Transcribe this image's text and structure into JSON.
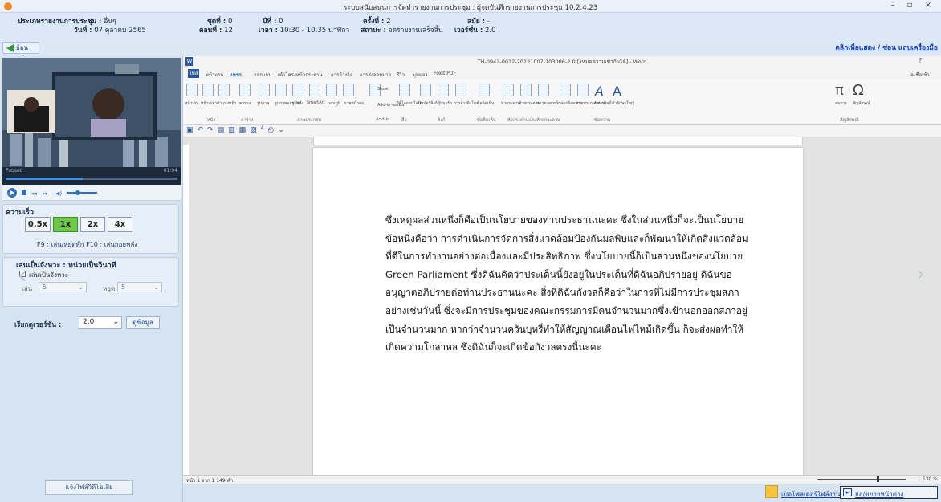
{
  "window": {
    "title": "ระบบสนับสนุนการจัดทำรายงานการประชุม : ผู้จดบันทึกรายงานการประชุม 10.2.4.23",
    "controls": "– ▫ ×"
  },
  "info": {
    "meeting_type_label": "ประเภทรายงานการประชุม :",
    "meeting_type_value": "อื่นๆ",
    "date_label": "วันที่ :",
    "date_value": "07 ตุลาคม 2565",
    "group_label": "ชุดที่ :",
    "group_value": "0",
    "year_label": "ปีที่ :",
    "year_value": "0",
    "session_label": "ครั้งที่ :",
    "session_value": "2",
    "term_label": "สมัย :",
    "term_value": "-",
    "episode_label": "ตอนที่ :",
    "episode_value": "12",
    "time_label": "เวลา :",
    "time_value": "10:30 - 10:35 นาฬิกา",
    "status_label": "สถานะ :",
    "status_value": "จดรายงานเสร็จสิ้น",
    "version_label": "เวอร์ชั่น :",
    "version_value": "2.0"
  },
  "toolbar": {
    "back_label": "ย้อนกลับ",
    "toggle_label": "คลิกเพื่อแสดง / ซ่อน แถบเครื่องมือ"
  },
  "player": {
    "state": "Paused",
    "time": "01:04",
    "progress": 0.45
  },
  "speed": {
    "title": "ความเร็ว",
    "options": [
      "0.5x",
      "1x",
      "2x",
      "4x"
    ],
    "selected": "1x",
    "hint": "F9 : เล่น/หยุดพัก  F10 : เล่นถอยหลัง"
  },
  "loop": {
    "title": "เล่นเป็นจังหวะ : หน่วยเป็นวินาที",
    "checkbox_label": "เล่นเป็นจังหวะ",
    "play_label": "เล่น",
    "play_value": "5",
    "pause_label": "หยุด",
    "pause_value": "5"
  },
  "version_select": {
    "label": "เรียกดูเวอร์ชั่น :",
    "value": "2.0",
    "view_button": "ดูข้อมูล"
  },
  "report_button": "แจ้งไฟล์วิดีโอเสีย",
  "word": {
    "title": "TH-0942-0012-20221007-103006-2.0 [โหมดความเข้ากันได้] - Word",
    "help": "?",
    "signin": "ลงชื่อเข้า",
    "tabs": [
      "ไฟล์",
      "หน้าแรก",
      "แทรก",
      "ออกแบบ",
      "เค้าโครงหน้ากระดาษ",
      "การอ้างอิง",
      "การส่งจดหมาย",
      "รีวิว",
      "มุมมอง",
      "Foxit PDF"
    ],
    "active_tab": "แทรก",
    "groups": [
      "หน้า",
      "ตาราง",
      "ภาพประกอบ",
      "Add-in",
      "สื่อ",
      "ลิงก์",
      "ข้อคิดเห็น",
      "หัวกระดาษและท้ายกระดาษ",
      "ข้อความ",
      "สัญลักษณ์"
    ],
    "ribbon_labels": [
      "หน้าปก",
      "หน้าเปล่า",
      "ตัวแบ่งหน้า",
      "ตาราง",
      "รูปภาพ",
      "รูปภาพออนไลน์",
      "รูปร่าง",
      "SmartArt",
      "แผนภูมิ",
      "ภาพหน้าจอ",
      "Store",
      "Add-in ของฉัน",
      "วิดีโอออนไลน์",
      "ไฮเปอร์ลิงก์",
      "บุ๊กมาร์ก",
      "การอ้างอิงโยง",
      "ข้อคิดเห็น",
      "หัวกระดาษ",
      "ท้ายกระดาษ",
      "หมายเลขหน้า",
      "กล่องข้อความ",
      "ส่วนประกอบด่วน",
      "อักษรศิลป์",
      "ตัวอักษรใหญ่",
      "สมการ",
      "สัญลักษณ์"
    ],
    "status": "หน้า 1 จาก 1    149 คำ",
    "zoom": "130 %",
    "document_lines": [
      "ซึ่งเหตุผลส่วนหนึ่งก็คือเป็นนโยบายของท่านประธานนะคะ ซึ่งในส่วนหนึ่งก็จะเป็นนโยบาย",
      "ข้อหนึ่งคือว่า การดำเนินการจัดการสิ่งแวดล้อมป้องกันมลพิษและก็พัฒนาให้เกิดสิ่งแวดล้อม",
      "ที่ดีในการทำงานอย่างต่อเนื่องและมีประสิทธิภาพ ซึ่งนโยบายนี้ก็เป็นส่วนหนึ่งของนโยบาย",
      "Green Parliament ซึ่งดิฉันคิดว่าประเด็นนี้ยังอยู่ในประเด็นที่ดิฉันอภิปรายอยู่ ดิฉันขอ",
      "อนุญาตอภิปรายต่อท่านประธานนะคะ สิ่งที่ดิฉันกังวลก็คือว่าในการที่ไม่มีการประชุมสภา",
      "อย่างเช่นวันนี้ ซึ่งจะมีการประชุมของคณะกรรมการมีคนจำนวนมากซึ่งเข้านอกออกสภาอยู่",
      "เป็นจำนวนมาก หากว่าจำนวนควันบุหรี่ทำให้สัญญาณเตือนไฟไหม้เกิดขึ้น ก็จะส่งผลทำให้",
      "เกิดความโกลาหล ซึ่งดิฉันก็จะเกิดข้อกังวลตรงนี้นะคะ"
    ]
  },
  "bottom": {
    "open_folder": "เปิดโฟลเดอร์ไฟล์งาน",
    "minimize_window": "ย่อ/ขยายหน้าต่าง"
  },
  "colors": {
    "accent": "#1540a8",
    "selected_speed": "#6fc84a",
    "word_blue": "#2b579a"
  }
}
